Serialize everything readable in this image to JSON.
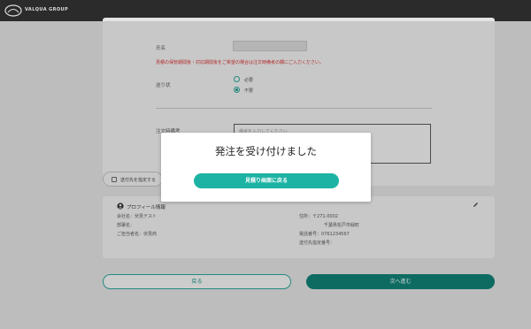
{
  "header": {
    "brand": "VALQUA GROUP",
    "logo_icon": "valqua-logo"
  },
  "form": {
    "name_label": "氏名",
    "notice": "見積の保管期間後・対応期間後をご希望の場合は注文時備考の欄にご入力ください。",
    "delivery_label": "送り状",
    "delivery_options": [
      {
        "label": "必要",
        "selected": false
      },
      {
        "label": "不要",
        "selected": true
      }
    ],
    "remarks_label": "注文時備考",
    "remarks_placeholder": "備考を入力してください"
  },
  "address_check_label": "送付先を指定する",
  "profile": {
    "title": "プロフィール情報",
    "left_lines": [
      "会社名：伏見テスト",
      "部署名：",
      "ご担当者名：伏見商"
    ],
    "right_lines": [
      "住所：〒271-0002",
      "千葉県松戸市緑町",
      "電話番号：0761234567",
      "送付先指定番号："
    ]
  },
  "buttons": {
    "back": "戻る",
    "next": "次へ進む"
  },
  "modal": {
    "title": "発注を受け付けました",
    "button": "見積り画面に戻る"
  },
  "colors": {
    "accent": "#1db3a4",
    "accent_dark": "#0f7a70",
    "topbar": "#2b2b2b",
    "notice": "#cc3333"
  }
}
